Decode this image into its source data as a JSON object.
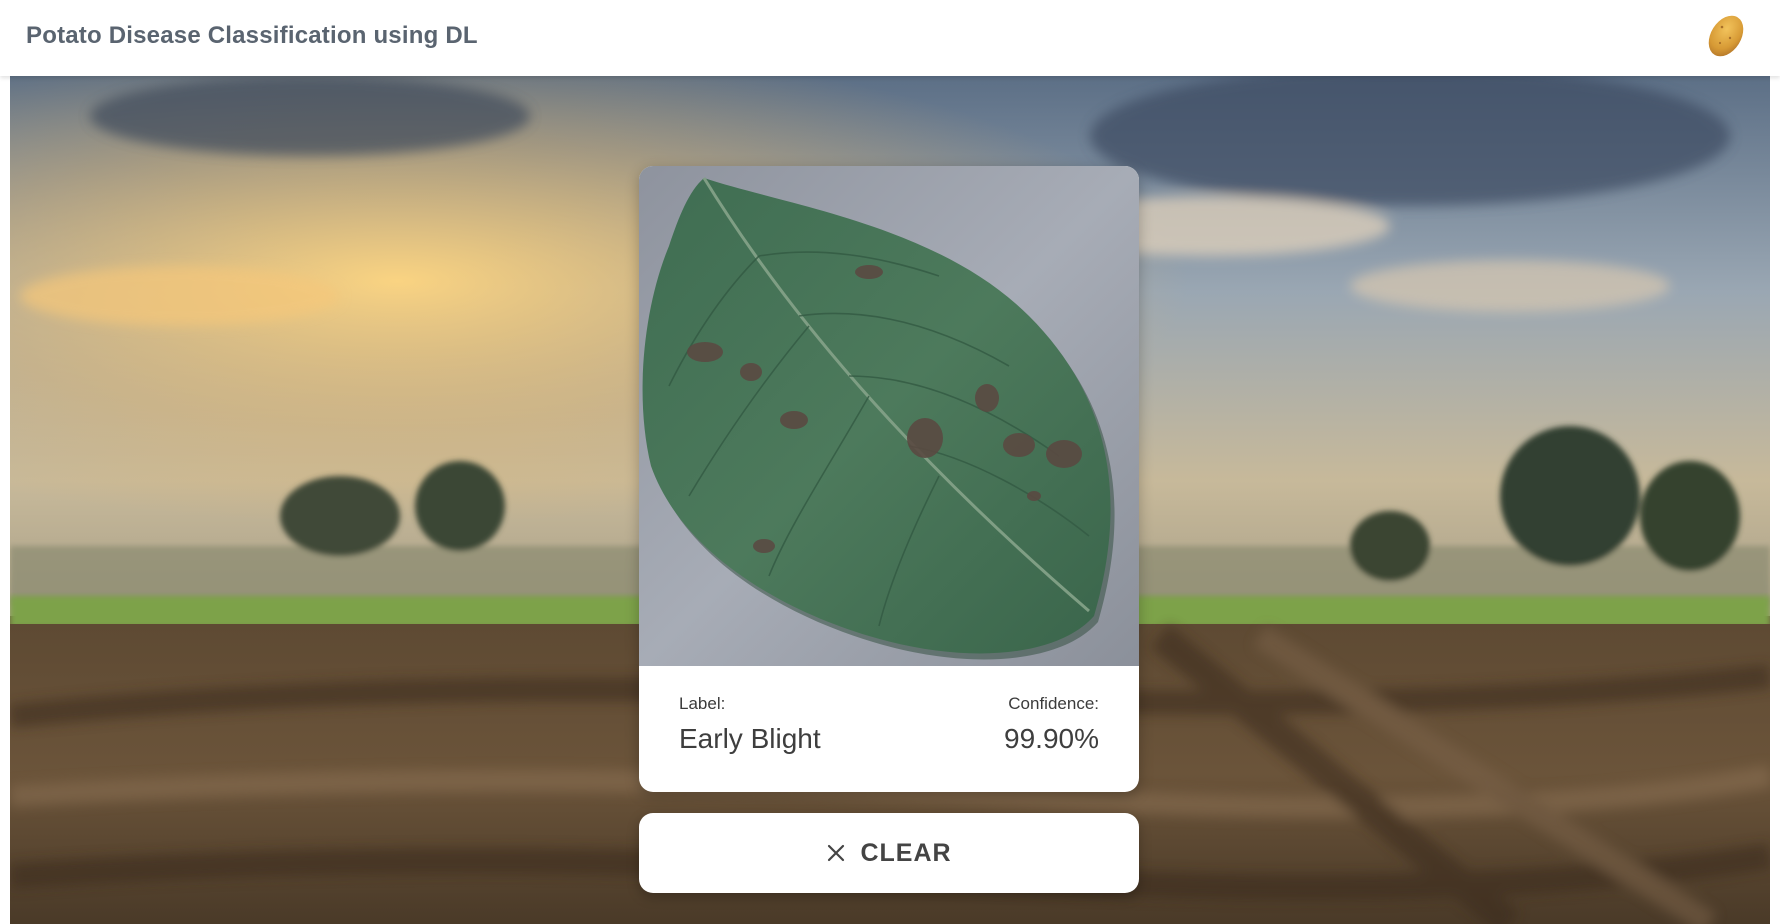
{
  "header": {
    "title": "Potato Disease Classification using DL",
    "logo_icon": "potato-icon"
  },
  "prediction": {
    "label_caption": "Label:",
    "label_value": "Early Blight",
    "confidence_caption": "Confidence:",
    "confidence_value": "99.90%"
  },
  "actions": {
    "clear_label": "CLEAR",
    "clear_icon": "close-icon"
  },
  "colors": {
    "header_text": "#5a6470",
    "potato": "#d9a441",
    "leaf": "#3e6a4e",
    "card_bg": "#ffffff"
  }
}
